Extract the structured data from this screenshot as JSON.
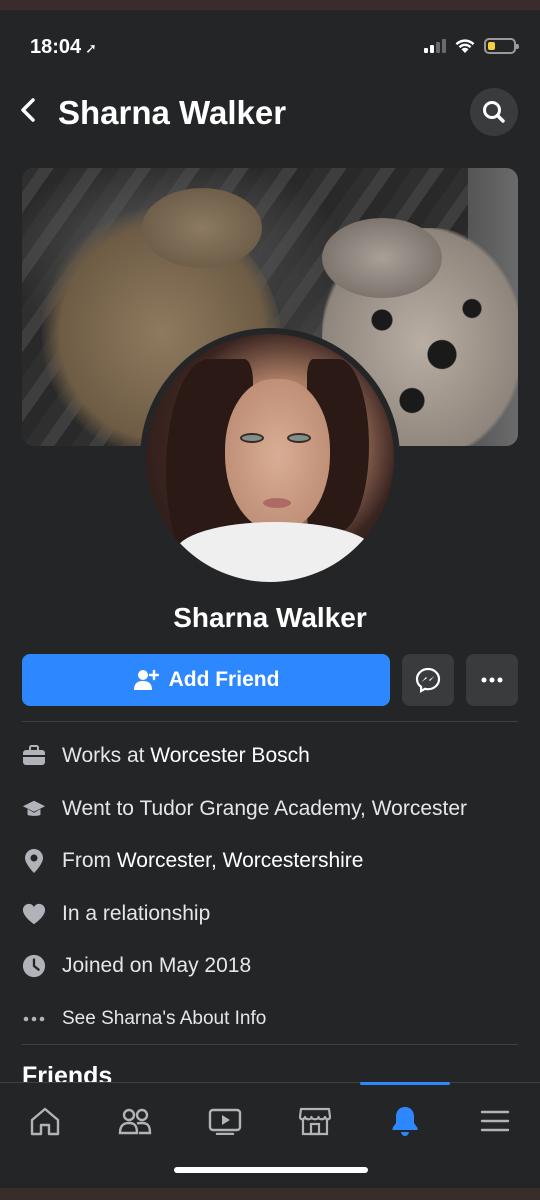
{
  "status_bar": {
    "time": "18:04",
    "location_arrow": "➚"
  },
  "header": {
    "back_icon": "chevron-left-icon",
    "title": "Sharna Walker",
    "search_icon": "search-icon"
  },
  "profile": {
    "name": "Sharna Walker",
    "add_friend_label": "Add Friend",
    "messenger_icon": "messenger-icon",
    "more_icon": "more-dots-icon"
  },
  "info": [
    {
      "icon": "briefcase-icon",
      "prefix": "Works at ",
      "value": "Worcester Bosch"
    },
    {
      "icon": "graduation-cap-icon",
      "prefix": "Went to Tudor Grange Academy, Worcester",
      "value": ""
    },
    {
      "icon": "location-pin-icon",
      "prefix": "From ",
      "value": "Worcester, Worcestershire"
    },
    {
      "icon": "heart-icon",
      "prefix": "In a relationship",
      "value": ""
    },
    {
      "icon": "clock-icon",
      "prefix": "Joined on May 2018",
      "value": ""
    },
    {
      "icon": "more-dots-icon",
      "prefix": "See Sharna's About Info",
      "value": ""
    }
  ],
  "friends_heading": "Friends",
  "tabs": [
    {
      "name": "home",
      "icon": "home-icon"
    },
    {
      "name": "friends",
      "icon": "friends-icon"
    },
    {
      "name": "watch",
      "icon": "video-icon"
    },
    {
      "name": "marketplace",
      "icon": "shop-icon"
    },
    {
      "name": "notifications",
      "icon": "bell-icon",
      "active": true
    },
    {
      "name": "menu",
      "icon": "menu-icon"
    }
  ],
  "colors": {
    "accent": "#2d88ff",
    "background": "#242526",
    "surface": "#3a3b3c"
  }
}
